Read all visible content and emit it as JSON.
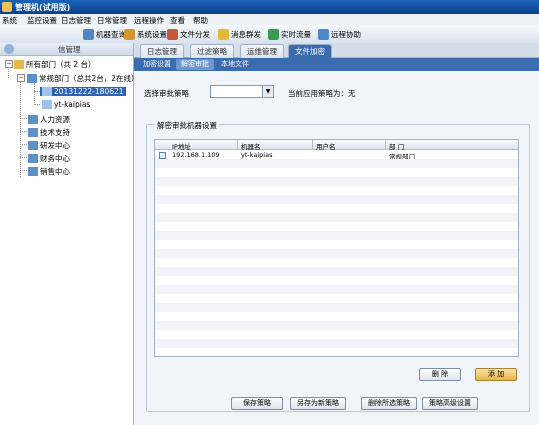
{
  "window": {
    "title": "管理机(试用版)"
  },
  "menu": [
    "系统",
    "监控设置",
    "日志管理",
    "日常管理",
    "远程操作",
    "查看",
    "帮助"
  ],
  "toolbar": {
    "items": [
      {
        "label": "机器查询",
        "icon": "search-computer-icon",
        "color": "#4f86c6"
      },
      {
        "label": "系统设置",
        "icon": "settings-icon",
        "color": "#d9962d"
      },
      {
        "label": "文件分发",
        "icon": "file-distribute-icon",
        "color": "#c45a3a"
      },
      {
        "label": "消息群发",
        "icon": "message-icon",
        "color": "#e2b93b"
      },
      {
        "label": "实时流量",
        "icon": "traffic-icon",
        "color": "#3a9a4f"
      },
      {
        "label": "远程协助",
        "icon": "remote-assist-icon",
        "color": "#4f86c6"
      }
    ]
  },
  "left_panel": {
    "header": "信管理",
    "tree": {
      "root": "所有部门（共 2 台）",
      "dept": "常规部门（总共2台，2在线）",
      "computers": [
        "20131222-180621",
        "yt-kaipias"
      ],
      "others": [
        "人力资源",
        "技术支持",
        "研发中心",
        "财务中心",
        "销售中心"
      ]
    }
  },
  "tabs_main": [
    "日志管理",
    "过滤策略",
    "运维管理",
    "文件加密"
  ],
  "tabs_sub": [
    "加密设置",
    "解密审批",
    "本地文件"
  ],
  "form": {
    "strategy_label": "选择审批策略",
    "strategy_value": "",
    "current_label": "当前应用策略为：",
    "current_value": "无"
  },
  "group": {
    "title": "解密审批机器设置",
    "columns": [
      "IP地址",
      "机器名",
      "用户名",
      "部 门"
    ],
    "rows": [
      {
        "ip": "192.168.1.109",
        "machine": "yt-kaipias",
        "user": "",
        "dept": "常规部门"
      }
    ],
    "delete_label": "删 除",
    "add_label": "添 加"
  },
  "bottom_buttons": [
    "保存策略",
    "另存为新策略",
    "删除所选策略",
    "策略高级设置"
  ],
  "colors": {
    "accent": "#3b6cb0",
    "title_bar": "#0a3f8c",
    "selected": "#2e63b4"
  }
}
